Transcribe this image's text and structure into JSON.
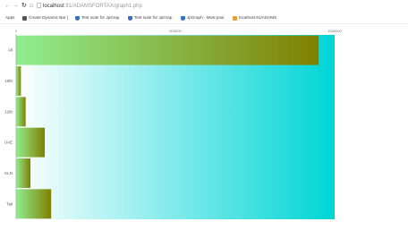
{
  "browser": {
    "nav_icons": [
      "back-arrow-icon",
      "forward-arrow-icon",
      "reload-icon",
      "home-icon",
      "page-icon"
    ],
    "url_host": "localhost",
    "url_path": ":81/ADAMSFORTAX/graph1.php",
    "bookmarks": [
      {
        "label": "Apps",
        "icon": "apps-grid-icon",
        "color": "#5b6b8c"
      },
      {
        "label": "Create Dynamic Bar (",
        "icon": "page-icon",
        "color": "#555555"
      },
      {
        "label": "Test suite for JpGrap",
        "icon": "shield-icon",
        "color": "#3a6fc4"
      },
      {
        "label": "Test suite for JpGrap",
        "icon": "shield-icon",
        "color": "#3a6fc4"
      },
      {
        "label": "JpGraph - Most pow",
        "icon": "shield-icon",
        "color": "#3a6fc4"
      },
      {
        "label": "localhost:81/ADAMS",
        "icon": "folder-icon",
        "color": "#e8a13a"
      }
    ]
  },
  "chart_data": {
    "type": "bar",
    "orientation": "horizontal",
    "categories": [
      "All",
      "10th",
      "12th",
      "UAE",
      "KLN",
      "Tail"
    ],
    "values": [
      95000,
      1500,
      3000,
      9000,
      4500,
      11000
    ],
    "x_ticks": [
      "0",
      "500000",
      "1000000"
    ],
    "xlim": [
      0,
      100000
    ],
    "grid": false,
    "colors": {
      "plot_bg_start": "#ffffff",
      "plot_bg_end": "#00d5d5",
      "bar_start": "#90ee90",
      "bar_end": "#808000"
    }
  }
}
